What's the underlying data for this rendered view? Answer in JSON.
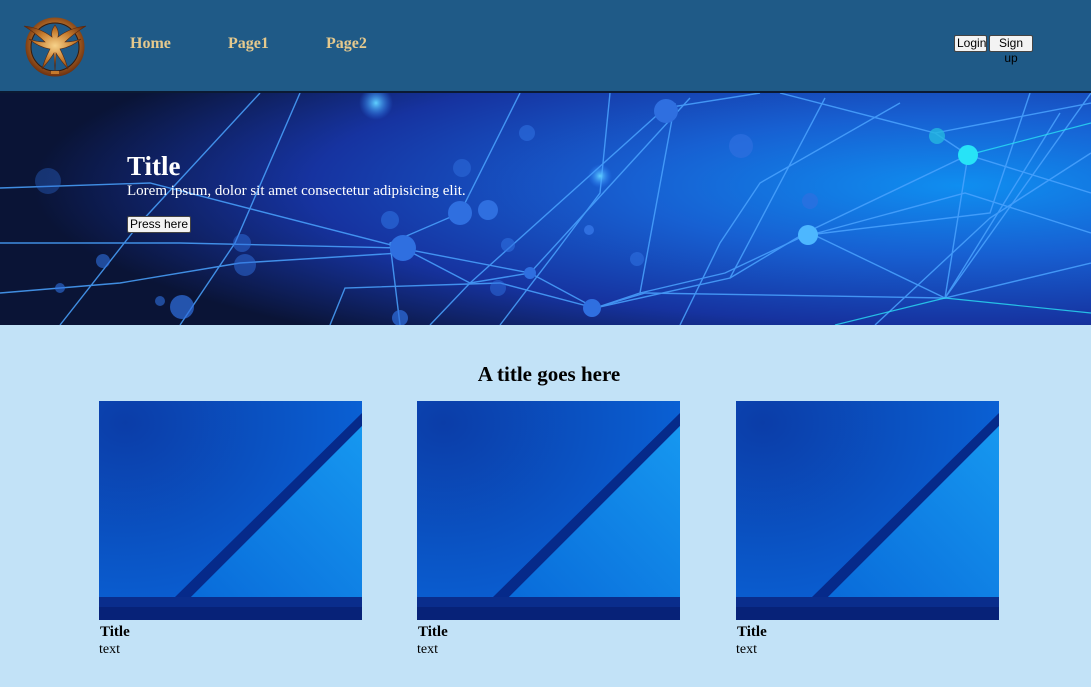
{
  "nav": {
    "links": [
      "Home",
      "Page1",
      "Page2"
    ],
    "login_label": "Login",
    "signup_label": "Sign up"
  },
  "hero": {
    "title": "Title",
    "text": "Lorem ipsum, dolor sit amet consectetur adipisicing elit.",
    "button_label": "Press here"
  },
  "section": {
    "title": "A title goes here",
    "cards": [
      {
        "title": "Title",
        "text": "text"
      },
      {
        "title": "Title",
        "text": "text"
      },
      {
        "title": "Title",
        "text": "text"
      }
    ]
  },
  "colors": {
    "header_bg": "#1f5a87",
    "nav_link": "#e5c98d",
    "page_bg": "#c2e2f7",
    "hero_dark": "#0a1436",
    "hero_blue": "#1a63d8"
  },
  "icons": {
    "logo": "mockingjay-logo"
  }
}
